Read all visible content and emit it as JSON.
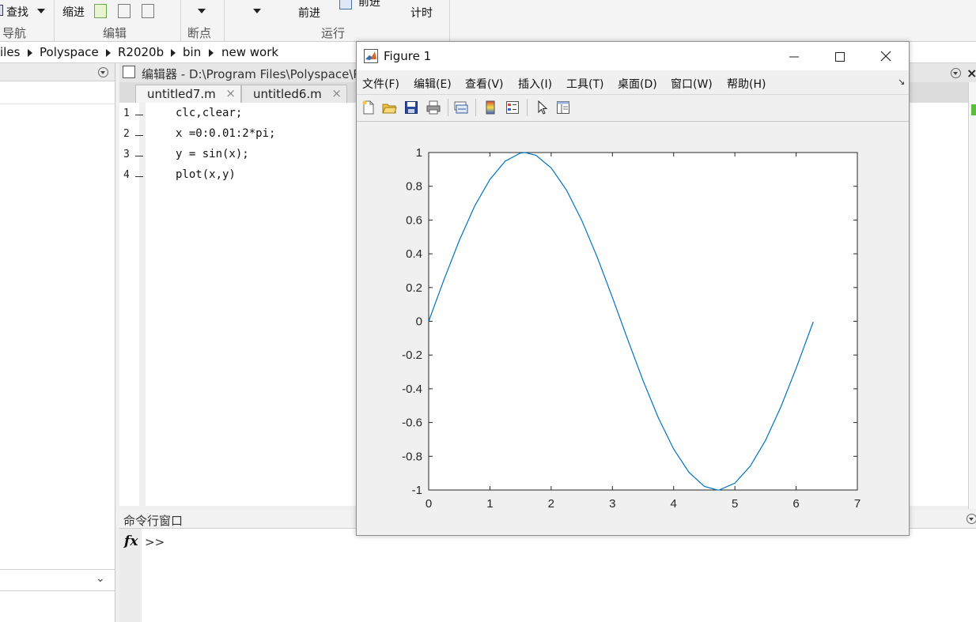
{
  "toolstrip": {
    "find_label": "查找",
    "indent_label": "缩进",
    "forward_label": "前进",
    "advance_label": "前进",
    "timing_label": "计时",
    "sections": {
      "navigate": "导航",
      "edit": "编辑",
      "breakpoints": "断点",
      "run": "运行"
    }
  },
  "breadcrumb": [
    "iles",
    "Polyspace",
    "R2020b",
    "bin",
    "new work"
  ],
  "editor": {
    "title": "编辑器 - D:\\Program Files\\Polyspace\\R",
    "tabs": [
      {
        "label": "untitled7.m",
        "close": "×"
      },
      {
        "label": "untitled6.m",
        "close": "×"
      }
    ],
    "lines": [
      {
        "num": "1",
        "code": "clc,clear;"
      },
      {
        "num": "2",
        "code": "x =0:0.01:2*pi;"
      },
      {
        "num": "3",
        "code": "y = sin(x);"
      },
      {
        "num": "4",
        "code": "plot(x,y)"
      }
    ]
  },
  "command_window": {
    "title": "命令行窗口",
    "fx": "fx",
    "prompt": ">>"
  },
  "figure": {
    "title": "Figure 1",
    "menu": [
      "文件(F)",
      "编辑(E)",
      "查看(V)",
      "插入(I)",
      "工具(T)",
      "桌面(D)",
      "窗口(W)",
      "帮助(H)"
    ],
    "toolbar_icons": [
      "new-file-icon",
      "open-folder-icon",
      "save-icon",
      "print-icon",
      "link-plot-icon",
      "colorbar-icon",
      "legend-icon",
      "pointer-icon",
      "property-editor-icon"
    ]
  },
  "chart_data": {
    "type": "line",
    "title": "",
    "xlabel": "",
    "ylabel": "",
    "xlim": [
      0,
      7
    ],
    "ylim": [
      -1,
      1
    ],
    "xticks": [
      0,
      1,
      2,
      3,
      4,
      5,
      6,
      7
    ],
    "yticks": [
      -1,
      -0.8,
      -0.6,
      -0.4,
      -0.2,
      0,
      0.2,
      0.4,
      0.6,
      0.8,
      1
    ],
    "ytick_labels": [
      "-1",
      "-0.8",
      "-0.6",
      "-0.4",
      "-0.2",
      "0",
      "0.2",
      "0.4",
      "0.6",
      "0.8",
      "1"
    ],
    "grid": false,
    "series": [
      {
        "color": "#0072bd",
        "x": [
          0,
          0.25,
          0.5,
          0.75,
          1,
          1.25,
          1.5,
          1.5708,
          1.75,
          2,
          2.25,
          2.5,
          2.75,
          3,
          3.25,
          3.5,
          3.75,
          4,
          4.25,
          4.5,
          4.7124,
          4.75,
          5,
          5.25,
          5.5,
          5.75,
          6,
          6.28
        ],
        "y": [
          0,
          0.247,
          0.479,
          0.682,
          0.841,
          0.949,
          0.997,
          1,
          0.984,
          0.909,
          0.778,
          0.598,
          0.382,
          0.141,
          -0.108,
          -0.351,
          -0.572,
          -0.757,
          -0.895,
          -0.978,
          -1,
          -0.999,
          -0.959,
          -0.859,
          -0.706,
          -0.508,
          -0.279,
          -0.003
        ]
      }
    ]
  }
}
